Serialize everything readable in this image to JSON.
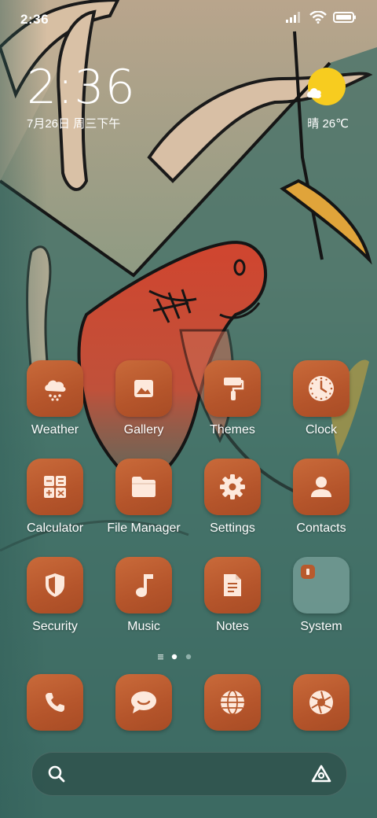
{
  "status_bar": {
    "time": "2:36",
    "icons": [
      "signal-icon",
      "wifi-icon",
      "battery-icon"
    ]
  },
  "clock_widget": {
    "time": "2:36",
    "date": "7月26日 周三下午"
  },
  "weather_widget": {
    "icon": "sunny-cloud-icon",
    "text": "晴 26℃"
  },
  "apps": [
    {
      "label": "Weather",
      "icon": "weather-icon"
    },
    {
      "label": "Gallery",
      "icon": "gallery-icon"
    },
    {
      "label": "Themes",
      "icon": "themes-icon"
    },
    {
      "label": "Clock",
      "icon": "clock-icon"
    },
    {
      "label": "Calculator",
      "icon": "calculator-icon"
    },
    {
      "label": "File Manager",
      "icon": "folder-icon"
    },
    {
      "label": "Settings",
      "icon": "gear-icon"
    },
    {
      "label": "Contacts",
      "icon": "person-icon"
    },
    {
      "label": "Security",
      "icon": "shield-icon"
    },
    {
      "label": "Music",
      "icon": "music-note-icon"
    },
    {
      "label": "Notes",
      "icon": "notes-icon"
    },
    {
      "label": "System",
      "icon": "folder-icon"
    }
  ],
  "dock": [
    {
      "icon": "phone-icon"
    },
    {
      "icon": "messages-icon"
    },
    {
      "icon": "browser-icon"
    },
    {
      "icon": "camera-icon"
    }
  ],
  "page_indicator": {
    "pages": 2,
    "current": 1
  },
  "search": {
    "icon": "search-icon",
    "assistant_icon": "assistant-icon"
  },
  "colors": {
    "icon_bg": "#b85a2d",
    "icon_glyph": "#fde9dc",
    "folder_bg": "#9fbab6",
    "wallpaper_teal": "#3f6b64",
    "fish_red": "#c8432f",
    "sun_yellow": "#f7cc1f"
  }
}
